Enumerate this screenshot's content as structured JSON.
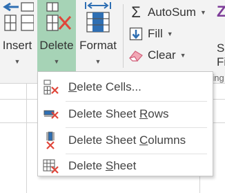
{
  "ribbon": {
    "cells_group": {
      "insert": {
        "label": "Insert"
      },
      "delete": {
        "label": "Delete"
      },
      "format": {
        "label": "Format"
      }
    },
    "editing_group": {
      "autosum": {
        "label": "AutoSum"
      },
      "fill": {
        "label": "Fill"
      },
      "clear": {
        "label": "Clear"
      },
      "clipped_label": "Editing",
      "clipped_right_top": "So",
      "clipped_right_bottom": "Fi",
      "clipped_right_icon": "Z"
    }
  },
  "delete_menu": {
    "items": [
      {
        "pre": "",
        "key": "D",
        "post": "elete Cells...",
        "icon": "delete-cells-icon"
      },
      {
        "pre": "Delete Sheet ",
        "key": "R",
        "post": "ows",
        "icon": "delete-sheet-rows-icon"
      },
      {
        "pre": "Delete Sheet ",
        "key": "C",
        "post": "olumns",
        "icon": "delete-sheet-columns-icon"
      },
      {
        "pre": "Delete ",
        "key": "S",
        "post": "heet",
        "icon": "delete-sheet-icon"
      }
    ]
  },
  "colors": {
    "active_button": "#a6d3b6",
    "delete_x": "#e0463a",
    "icon_blue": "#2f6fb3",
    "autosum_purple": "#7d3c98"
  }
}
